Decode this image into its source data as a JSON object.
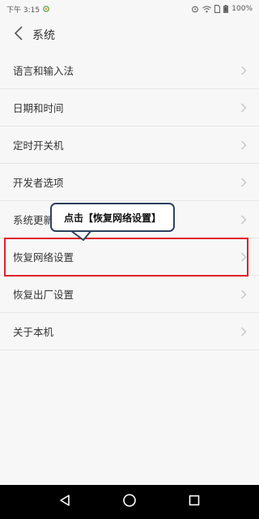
{
  "status_bar": {
    "time": "下午 3:15",
    "battery": "100%",
    "icons": [
      "notification-icon",
      "alarm-icon",
      "wifi-icon",
      "sim-icon",
      "battery-icon"
    ]
  },
  "header": {
    "title": "系统",
    "back_icon": "chevron-left-icon"
  },
  "settings": {
    "items": [
      {
        "label": "语言和输入法"
      },
      {
        "label": "日期和时间"
      },
      {
        "label": "定时开关机"
      },
      {
        "label": "开发者选项"
      },
      {
        "label": "系统更新"
      },
      {
        "label": "恢复网络设置"
      },
      {
        "label": "恢复出厂设置"
      },
      {
        "label": "关于本机"
      }
    ]
  },
  "callout": {
    "text": "点击【恢复网络设置】"
  },
  "highlight": {
    "target": "恢复网络设置",
    "color": "#e0202a"
  },
  "nav_bar": {
    "buttons": [
      "back-triangle-icon",
      "home-circle-icon",
      "recents-square-icon"
    ]
  },
  "colors": {
    "background": "#f7f7f7",
    "text": "#333333",
    "callout_border": "#2e4160",
    "nav_background": "#000000"
  }
}
